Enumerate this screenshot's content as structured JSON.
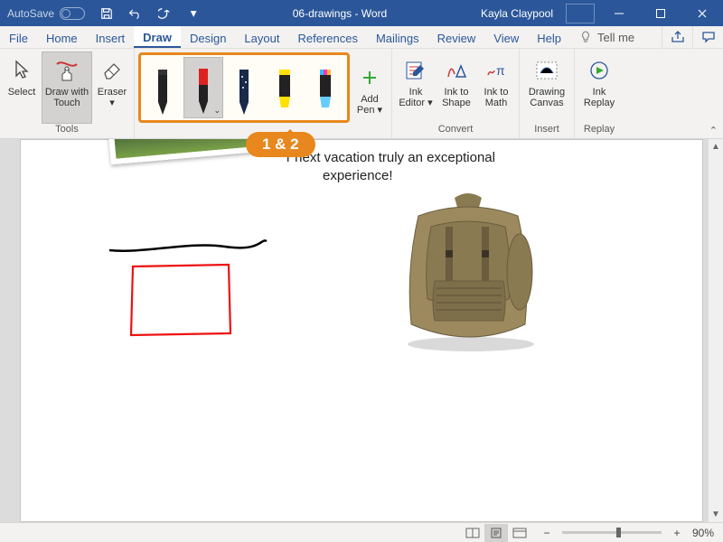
{
  "titlebar": {
    "autosave": "AutoSave",
    "doc_title": "06-drawings - Word",
    "user": "Kayla Claypool"
  },
  "tabs": {
    "items": [
      "File",
      "Home",
      "Insert",
      "Draw",
      "Design",
      "Layout",
      "References",
      "Mailings",
      "Review",
      "View",
      "Help"
    ],
    "active": "Draw",
    "tell_me": "Tell me"
  },
  "ribbon": {
    "tools": {
      "label": "Tools",
      "select": "Select",
      "draw_touch_1": "Draw with",
      "draw_touch_2": "Touch",
      "eraser": "Eraser"
    },
    "pens": {
      "add_pen_1": "Add",
      "add_pen_2": "Pen"
    },
    "convert": {
      "label": "Convert",
      "ink_editor_1": "Ink",
      "ink_editor_2": "Editor",
      "ink_shape_1": "Ink to",
      "ink_shape_2": "Shape",
      "ink_math_1": "Ink to",
      "ink_math_2": "Math"
    },
    "insert": {
      "label": "Insert",
      "canvas_1": "Drawing",
      "canvas_2": "Canvas"
    },
    "replay": {
      "label": "Replay",
      "replay_1": "Ink",
      "replay_2": "Replay"
    }
  },
  "callout": "1 & 2",
  "doc": {
    "line1": "r next vacation truly an exceptional",
    "line2": "experience!"
  },
  "status": {
    "zoom": "90%",
    "minus": "−",
    "plus": "+"
  }
}
